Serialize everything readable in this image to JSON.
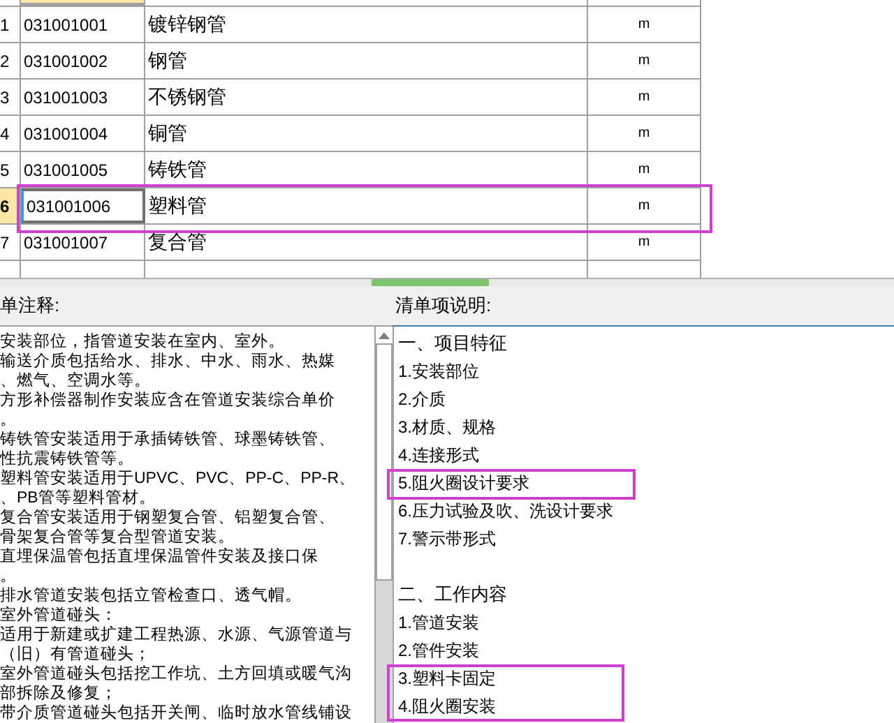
{
  "table": {
    "rows": [
      {
        "number": "1",
        "code": "031001001",
        "name": "镀锌钢管",
        "unit": "m",
        "selected": false
      },
      {
        "number": "2",
        "code": "031001002",
        "name": "钢管",
        "unit": "m",
        "selected": false
      },
      {
        "number": "3",
        "code": "031001003",
        "name": "不锈钢管",
        "unit": "m",
        "selected": false
      },
      {
        "number": "4",
        "code": "031001004",
        "name": "铜管",
        "unit": "m",
        "selected": false
      },
      {
        "number": "5",
        "code": "031001005",
        "name": "铸铁管",
        "unit": "m",
        "selected": false
      },
      {
        "number": "6",
        "code": "031001006",
        "name": "塑料管",
        "unit": "m",
        "selected": true
      },
      {
        "number": "7",
        "code": "031001007",
        "name": "复合管",
        "unit": "m",
        "selected": false
      }
    ]
  },
  "notes_panel": {
    "title": "单注释:",
    "lines": [
      "安装部位，指管道安装在室内、室外。",
      "输送介质包括给水、排水、中水、雨水、热媒",
      "、燃气、空调水等。",
      "方形补偿器制作安装应含在管道安装综合单价",
      "。",
      "铸铁管安装适用于承插铸铁管、球墨铸铁管、",
      "性抗震铸铁管等。",
      "塑料管安装适用于UPVC、PVC、PP-C、PP-R、",
      "、PB管等塑料管材。",
      "复合管安装适用于钢塑复合管、铝塑复合管、",
      "骨架复合管等复合型管道安装。",
      "直埋保温管包括直埋保温管件安装及接口保",
      "。",
      "排水管道安装包括立管检查口、透气帽。",
      "室外管道碰头：",
      "适用于新建或扩建工程热源、水源、气源管道与",
      "（旧）有管道碰头；",
      "室外管道碰头包括挖工作坑、土方回填或暖气沟",
      "部拆除及修复；",
      "带介质管道碰头包括开关闸、临时放水管线铺设"
    ]
  },
  "description_panel": {
    "title": "清单项说明:",
    "sections": [
      {
        "heading": "一、项目特征",
        "items": [
          "1.安装部位",
          "2.介质",
          "3.材质、规格",
          "4.连接形式",
          "5.阻火圈设计要求",
          "6.压力试验及吹、洗设计要求",
          "7.警示带形式"
        ]
      },
      {
        "heading": "二、工作内容",
        "items": [
          "1.管道安装",
          "2.管件安装",
          "3.塑料卡固定",
          "4.阻火圈安装"
        ]
      }
    ]
  }
}
